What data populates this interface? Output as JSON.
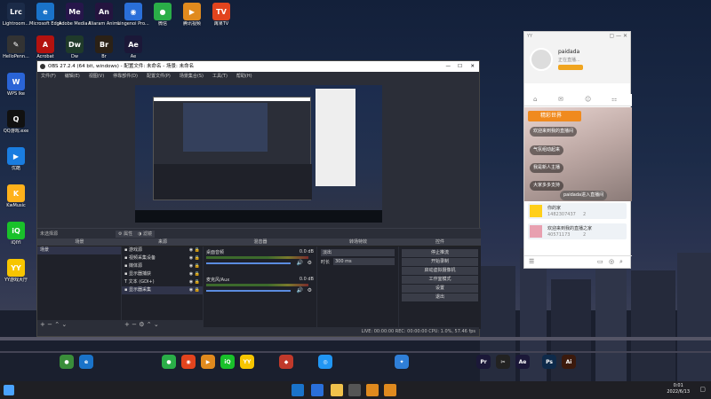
{
  "desktop": {
    "icons": [
      {
        "label": "Lightroom...",
        "glyph": "Lrc",
        "color": "#1b2b48",
        "icon": "lightroom-icon"
      },
      {
        "label": "Microsoft Edge",
        "glyph": "e",
        "color": "#1a73c9",
        "icon": "edge-icon"
      },
      {
        "label": "Adobe Media Enc...",
        "glyph": "Me",
        "color": "#26164a",
        "icon": "media-encoder-icon"
      },
      {
        "label": "Aliaram Animate...",
        "glyph": "An",
        "color": "#24143f",
        "icon": "animate-icon"
      },
      {
        "label": "Lingenoi Pro...",
        "glyph": "◉",
        "color": "#2a6fd9",
        "icon": "app-icon"
      },
      {
        "label": "微信",
        "glyph": "●",
        "color": "#2aae48",
        "icon": "wechat-icon"
      },
      {
        "label": "腾讯视频",
        "glyph": "▶",
        "color": "#e08a1e",
        "icon": "tencent-video-icon"
      },
      {
        "label": "苒果TV",
        "glyph": "TV",
        "color": "#e2441e",
        "icon": "mango-tv-icon"
      },
      {
        "label": "HelloPenn...",
        "glyph": "✎",
        "color": "#333",
        "icon": "pen-icon"
      },
      {
        "label": "Acrobat",
        "glyph": "A",
        "color": "#b3120f",
        "icon": "acrobat-icon"
      },
      {
        "label": "Dw",
        "glyph": "Dw",
        "color": "#1f3a2a",
        "icon": "dreamweaver-icon"
      },
      {
        "label": "Br",
        "glyph": "Br",
        "color": "#2b2116",
        "icon": "bridge-icon"
      },
      {
        "label": "Ae",
        "glyph": "Ae",
        "color": "#1b1838",
        "icon": "after-effects-icon"
      }
    ],
    "left_icons": [
      {
        "label": "WPS Ike",
        "glyph": "W",
        "color": "#2a64d6",
        "icon": "wps-icon"
      },
      {
        "label": "QQ游戏.exe",
        "glyph": "Q",
        "color": "#111",
        "icon": "qq-icon"
      },
      {
        "label": "优酷",
        "glyph": "▶",
        "color": "#1a7de0",
        "icon": "youku-icon"
      },
      {
        "label": "KwMusic",
        "glyph": "K",
        "color": "#ffb11b",
        "icon": "kuwo-icon"
      },
      {
        "label": "iQIYI",
        "glyph": "iQ",
        "color": "#19c12a",
        "icon": "iqiyi-icon"
      },
      {
        "label": "YY游戏大厅",
        "glyph": "YY",
        "color": "#f7c500",
        "icon": "yy-icon"
      }
    ],
    "taskbar": {
      "time": "0:01",
      "date": "2022/6/13"
    }
  },
  "obs": {
    "title": "OBS 27.2.4 (64 bit, windows) - 配置文件: 未命名 - 场景: 未命名",
    "menu": [
      "文件(F)",
      "编辑(E)",
      "视图(V)",
      "停靠部件(D)",
      "配置文件(P)",
      "场景集合(S)",
      "工具(T)",
      "帮助(H)"
    ],
    "no_source": "未选择源",
    "prop_btn": "属性",
    "filter_btn": "滤镜",
    "docks": [
      "场景",
      "来源",
      "混音器",
      "转场特效",
      "控件"
    ],
    "scenes": [
      "场景"
    ],
    "sources": [
      "游戏源",
      "视频采集设备",
      "媒体源",
      "显示器捕获",
      "文本 (GDI+)",
      "显示器采集"
    ],
    "mixer": [
      {
        "name": "桌面音频",
        "db": "0.0 dB"
      },
      {
        "name": "麦克风/Aux",
        "db": "0.0 dB"
      }
    ],
    "transition": {
      "name": "淡出",
      "duration_label": "时长",
      "duration": "300 ms"
    },
    "controls": [
      "停止推流",
      "开始录制",
      "启动虚拟摄像机",
      "工作室模式",
      "设置",
      "退出"
    ],
    "status": "LIVE: 00:00:00   REC: 00:00:00   CPU: 1.0%, 57.46 fps"
  },
  "yy": {
    "app": "YY",
    "name": "paidada",
    "status_line": "正在直播...",
    "tab_title": "精彩世界",
    "comments": [
      "欢迎来到我的直播间",
      "气氛组动起来",
      "我是新人主播",
      "大家多多支持",
      "paidada进入直播间"
    ],
    "card1": {
      "title": "你的家",
      "id": "1482307437",
      "count": "2"
    },
    "card2": {
      "title": "欢迎来到我的直播之家",
      "id": "40571173",
      "count": "2"
    }
  }
}
